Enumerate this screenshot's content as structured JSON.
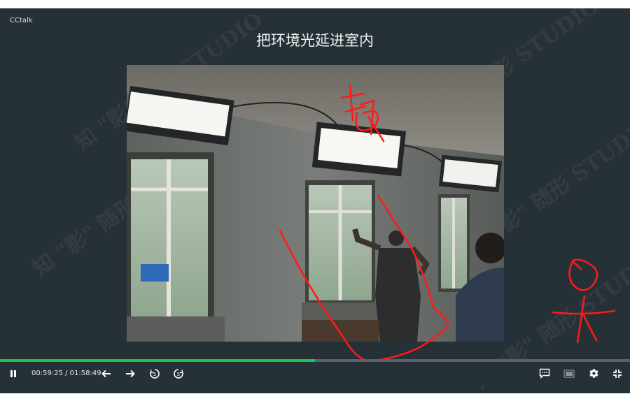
{
  "app": {
    "name": "CCtalk"
  },
  "slide": {
    "title": "把环境光延进室内"
  },
  "player": {
    "current_time": "00:59:25",
    "separator": "/",
    "total_time": "01:58:49",
    "progress_fraction": 0.5,
    "skip_back_seconds": "5",
    "skip_forward_seconds": "5"
  },
  "colors": {
    "background": "#263037",
    "progress": "#19c852",
    "annotation": "#ff1a1a"
  },
  "icons": [
    "pause-icon",
    "arrow-left-icon",
    "arrow-right-icon",
    "replay-5-icon",
    "forward-5-icon",
    "chat-icon",
    "screen-icon",
    "gear-icon",
    "exit-fullscreen-icon"
  ]
}
